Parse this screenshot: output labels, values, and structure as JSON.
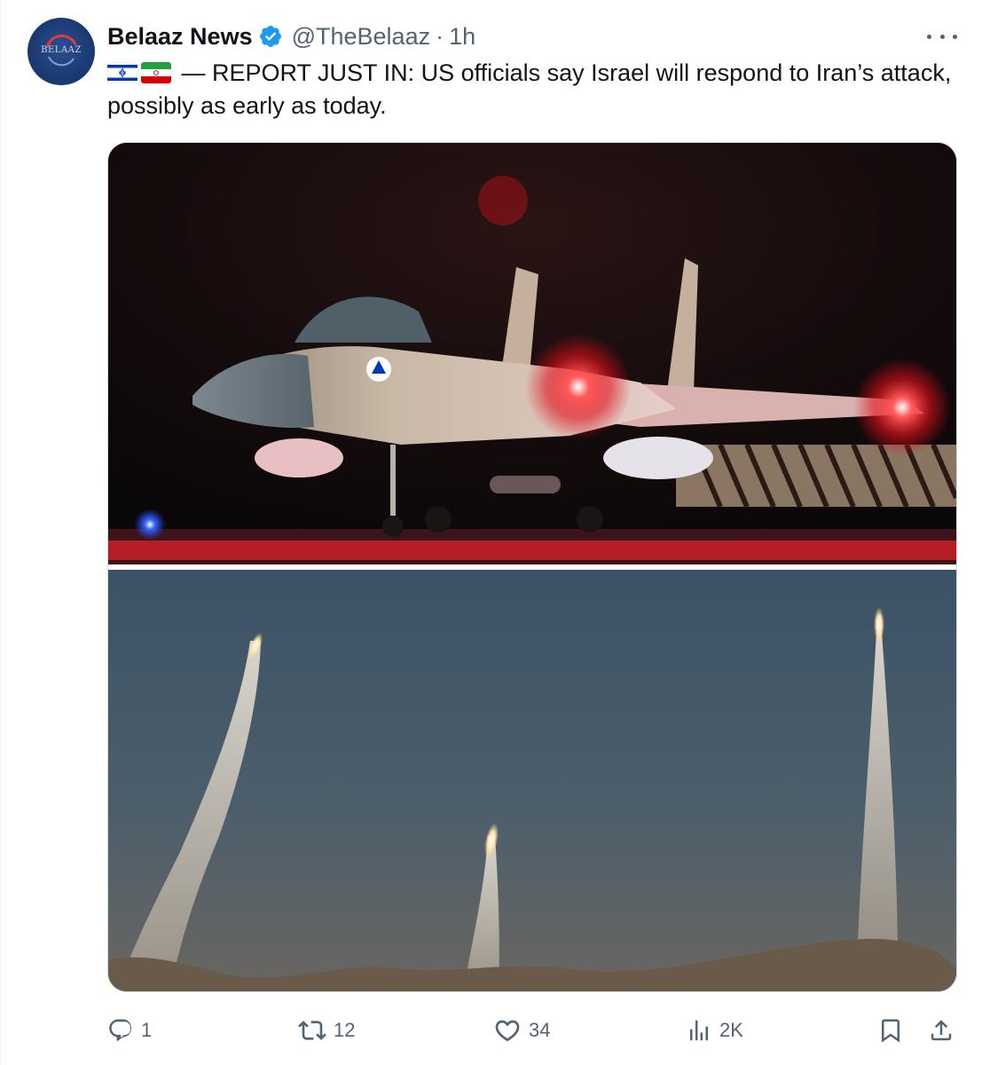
{
  "tweet": {
    "author_name": "Belaaz News",
    "handle": "@TheBelaaz",
    "separator": "·",
    "time": "1h",
    "avatar_text": "BELAAZ",
    "text": "— REPORT JUST IN: US officials say Israel will respond to Iran’s attack, possibly as early as today.",
    "flags": [
      "israel-flag-icon",
      "iran-flag-icon"
    ],
    "media": [
      {
        "alt_label": "Fighter jet on runway at night"
      },
      {
        "alt_label": "Missiles launching at dusk"
      }
    ]
  },
  "actions": {
    "replies": "1",
    "reposts": "12",
    "likes": "34",
    "views": "2K"
  },
  "icons": {
    "reply": "reply-icon",
    "repost": "repost-icon",
    "like": "heart-icon",
    "views": "views-icon",
    "bookmark": "bookmark-icon",
    "share": "share-icon",
    "verified": "verified-badge-icon",
    "more": "more-icon"
  },
  "colors": {
    "verified": "#1d9bf0",
    "secondary_text": "#536471",
    "primary_text": "#0f1419",
    "border": "#cfd9de"
  }
}
